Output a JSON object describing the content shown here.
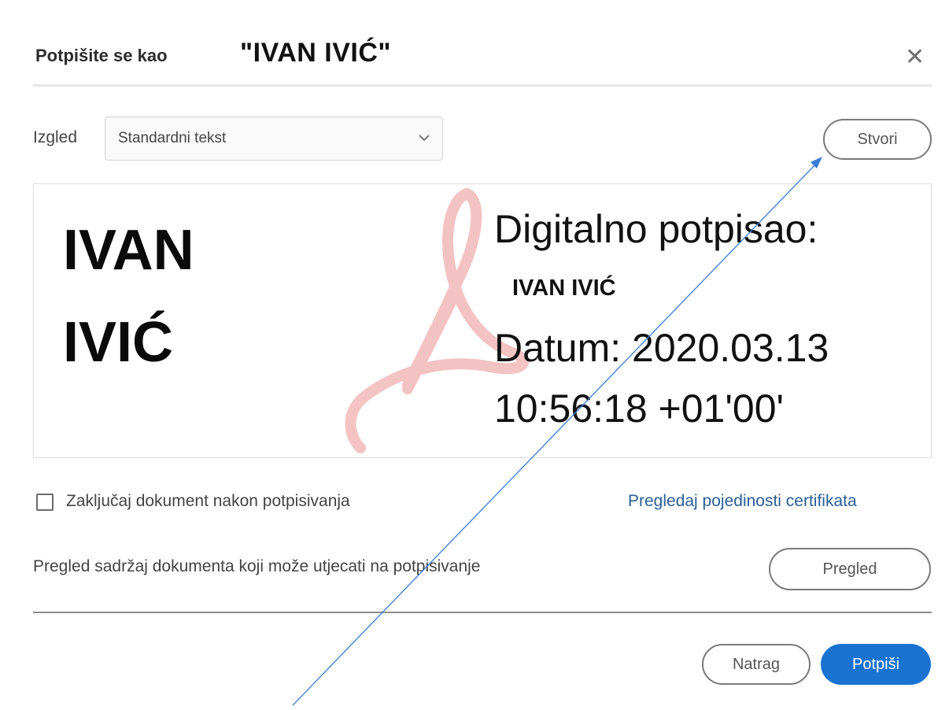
{
  "dialog": {
    "title_prefix": "Potpišite se kao",
    "title_name": "\"IVAN IVIĆ\"",
    "close_icon": "close-icon"
  },
  "appearance": {
    "label": "Izgled",
    "selected": "Standardni tekst",
    "create_button": "Stvori"
  },
  "signature_preview": {
    "name_line_1": "IVAN",
    "name_line_2": "IVIĆ",
    "digital_label": "Digitalno potpisao:",
    "signer": "IVAN IVIĆ",
    "date_line": "Datum: 2020.03.13",
    "time_line": "10:56:18 +01'00'",
    "watermark": "adobe-acrobat-logo"
  },
  "options": {
    "lock_label": "Zaključaj dokument nakon potpisivanja",
    "lock_checked": false,
    "cert_link": "Pregledaj pojedinosti certifikata",
    "review_text": "Pregled sadržaj dokumenta koji može utjecati na potpisivanje",
    "review_button": "Pregled"
  },
  "footer": {
    "back_button": "Natrag",
    "sign_button": "Potpiši"
  },
  "colors": {
    "primary": "#1a73d1",
    "link": "#2a5f96",
    "watermark": "#f2b8b8",
    "annotation_arrow": "#3a7bd5"
  }
}
